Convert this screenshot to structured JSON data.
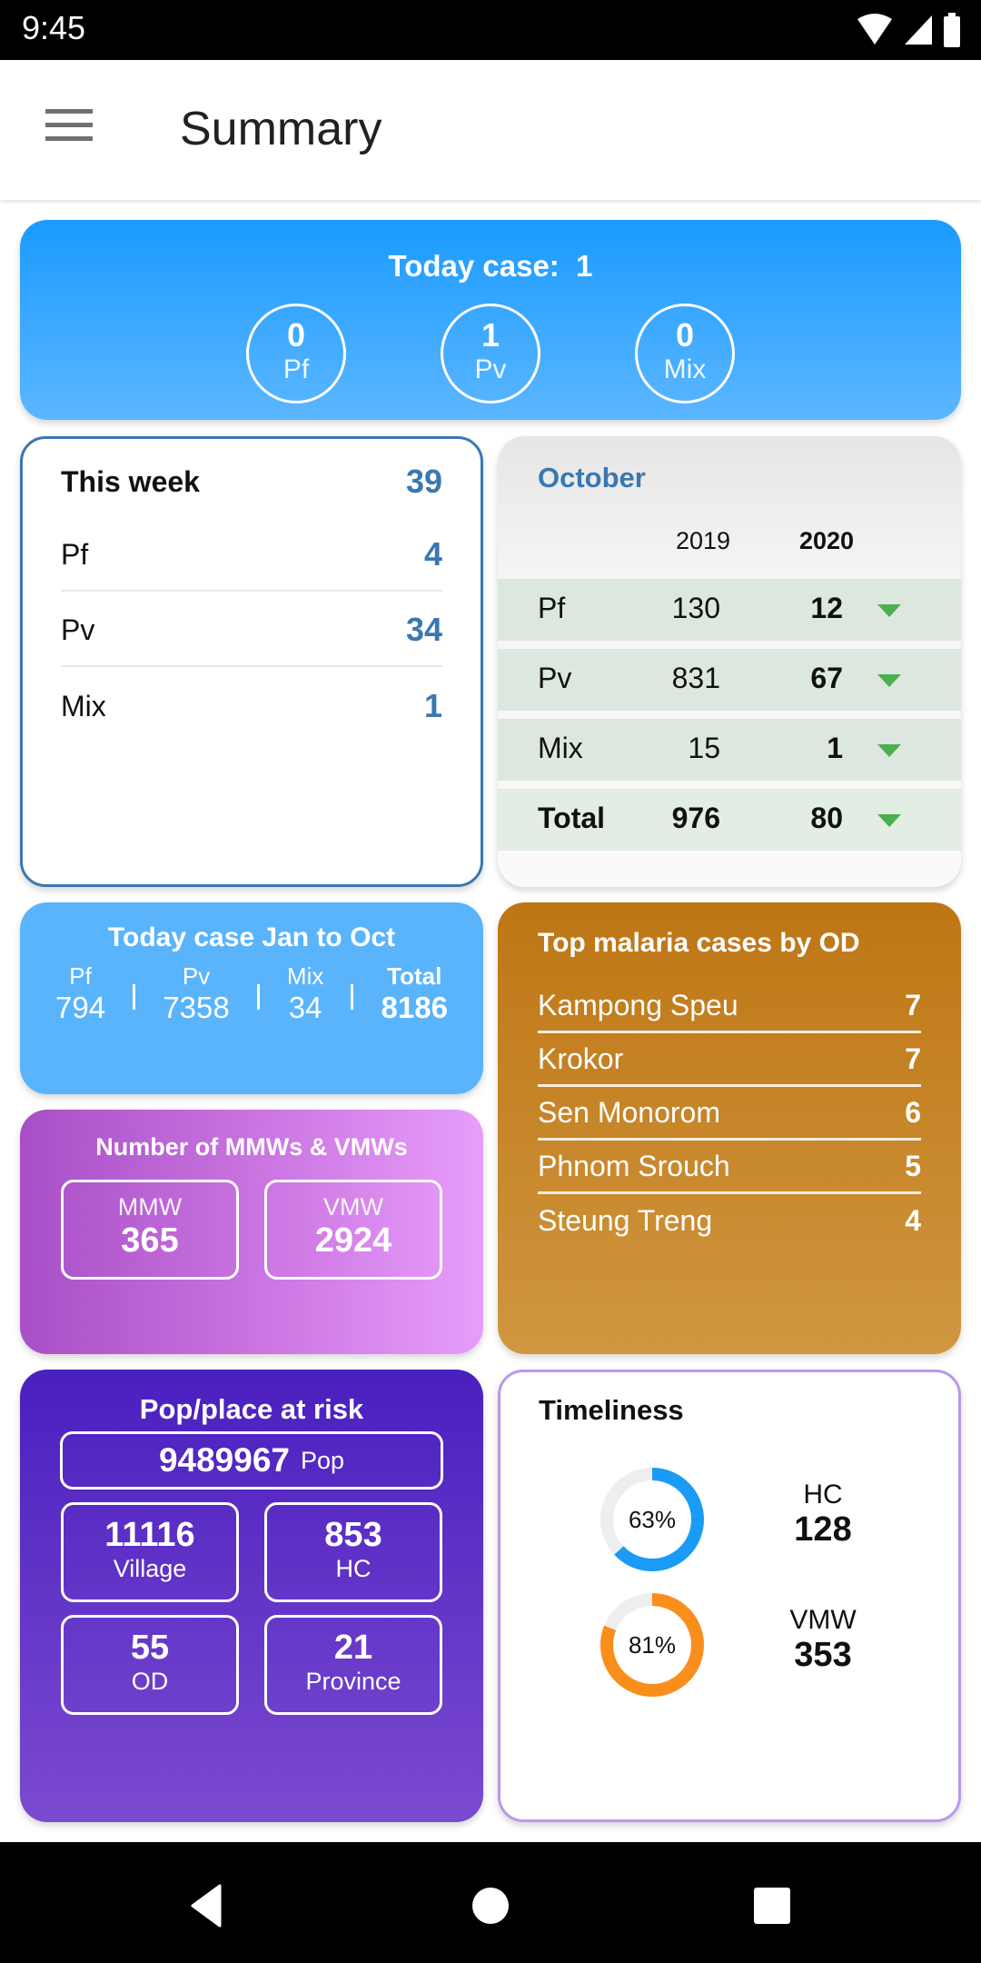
{
  "status_bar": {
    "time": "9:45",
    "icons": [
      "wifi-icon",
      "signal-icon",
      "battery-icon"
    ]
  },
  "app_bar": {
    "title": "Summary",
    "menu_icon": "hamburger-menu-icon"
  },
  "today_case": {
    "title": "Today case:",
    "total": "1",
    "items": [
      {
        "value": "0",
        "label": "Pf"
      },
      {
        "value": "1",
        "label": "Pv"
      },
      {
        "value": "0",
        "label": "Mix"
      }
    ]
  },
  "this_week": {
    "title": "This week",
    "total": "39",
    "rows": [
      {
        "label": "Pf",
        "value": "4"
      },
      {
        "label": "Pv",
        "value": "34"
      },
      {
        "label": "Mix",
        "value": "1"
      }
    ]
  },
  "october": {
    "title": "October",
    "columns": [
      "2019",
      "2020"
    ],
    "rows": [
      {
        "label": "Pf",
        "y2019": "130",
        "y2020": "12",
        "trend": "down"
      },
      {
        "label": "Pv",
        "y2019": "831",
        "y2020": "67",
        "trend": "down"
      },
      {
        "label": "Mix",
        "y2019": "15",
        "y2020": "1",
        "trend": "down"
      },
      {
        "label": "Total",
        "y2019": "976",
        "y2020": "80",
        "trend": "down"
      }
    ],
    "trend_color": "#4caf50"
  },
  "jan_to_oct": {
    "title": "Today case Jan to Oct",
    "items": [
      {
        "label": "Pf",
        "value": "794"
      },
      {
        "label": "Pv",
        "value": "7358"
      },
      {
        "label": "Mix",
        "value": "34"
      },
      {
        "label": "Total",
        "value": "8186"
      }
    ]
  },
  "top_od": {
    "title": "Top malaria cases by OD",
    "rows": [
      {
        "name": "Kampong Speu",
        "value": "7"
      },
      {
        "name": "Krokor",
        "value": "7"
      },
      {
        "name": "Sen Monorom",
        "value": "6"
      },
      {
        "name": "Phnom Srouch",
        "value": "5"
      },
      {
        "name": "Steung Treng",
        "value": "4"
      }
    ]
  },
  "workers": {
    "title": "Number of MMWs & VMWs",
    "items": [
      {
        "label": "MMW",
        "value": "365"
      },
      {
        "label": "VMW",
        "value": "2924"
      }
    ]
  },
  "pop_risk": {
    "title": "Pop/place at risk",
    "pop": {
      "value": "9489967",
      "label": "Pop"
    },
    "items": [
      {
        "value": "11116",
        "label": "Village"
      },
      {
        "value": "853",
        "label": "HC"
      },
      {
        "value": "55",
        "label": "OD"
      },
      {
        "value": "21",
        "label": "Province"
      }
    ]
  },
  "timeliness": {
    "title": "Timeliness",
    "items": [
      {
        "percent": 63,
        "percent_label": "63%",
        "label": "HC",
        "value": "128",
        "color": "#1a9bf6"
      },
      {
        "percent": 81,
        "percent_label": "81%",
        "label": "VMW",
        "value": "353",
        "color": "#f98e1c"
      }
    ],
    "track_color": "#eeeeee"
  },
  "nav_bar": {
    "buttons": [
      "back",
      "home",
      "recents"
    ]
  }
}
